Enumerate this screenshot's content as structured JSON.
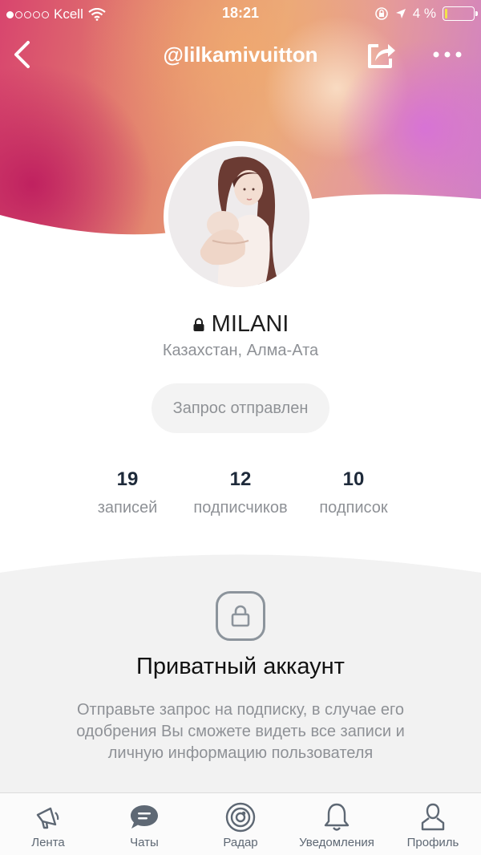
{
  "status_bar": {
    "carrier": "Kcell",
    "time": "18:21",
    "battery_text": "4 %",
    "signal_bars_filled": 1,
    "signal_bars_total": 5,
    "battery_level": 0.04,
    "icons": [
      "wifi-icon",
      "orientation-lock-icon",
      "location-arrow-icon",
      "battery-icon"
    ]
  },
  "nav": {
    "title": "@lilkamivuitton",
    "icons": [
      "back-chevron-icon",
      "share-icon",
      "more-dots-icon"
    ]
  },
  "profile": {
    "name": "MILANI",
    "location": "Казахстан, Алма-Ата",
    "request_button": "Запрос отправлен",
    "stats": [
      {
        "value": "19",
        "label": "записей"
      },
      {
        "value": "12",
        "label": "подписчиков"
      },
      {
        "value": "10",
        "label": "подписок"
      }
    ]
  },
  "private": {
    "title": "Приватный аккаунт",
    "description": "Отправьте запрос на подписку, в случае его одобрения Вы сможете видеть все записи и личную информацию пользователя"
  },
  "tab_bar": {
    "items": [
      {
        "label": "Лента",
        "icon": "megaphone-icon",
        "active": false
      },
      {
        "label": "Чаты",
        "icon": "chat-bubble-icon",
        "active": true
      },
      {
        "label": "Радар",
        "icon": "radar-icon",
        "active": false
      },
      {
        "label": "Уведомления",
        "icon": "bell-icon",
        "active": false
      },
      {
        "label": "Профиль",
        "icon": "person-icon",
        "active": false
      }
    ]
  },
  "colors": {
    "accent": "#5e6874",
    "text_secondary": "#8e9196",
    "private_background": "#f2f2f2",
    "battery_fill": "#f2e24a"
  }
}
